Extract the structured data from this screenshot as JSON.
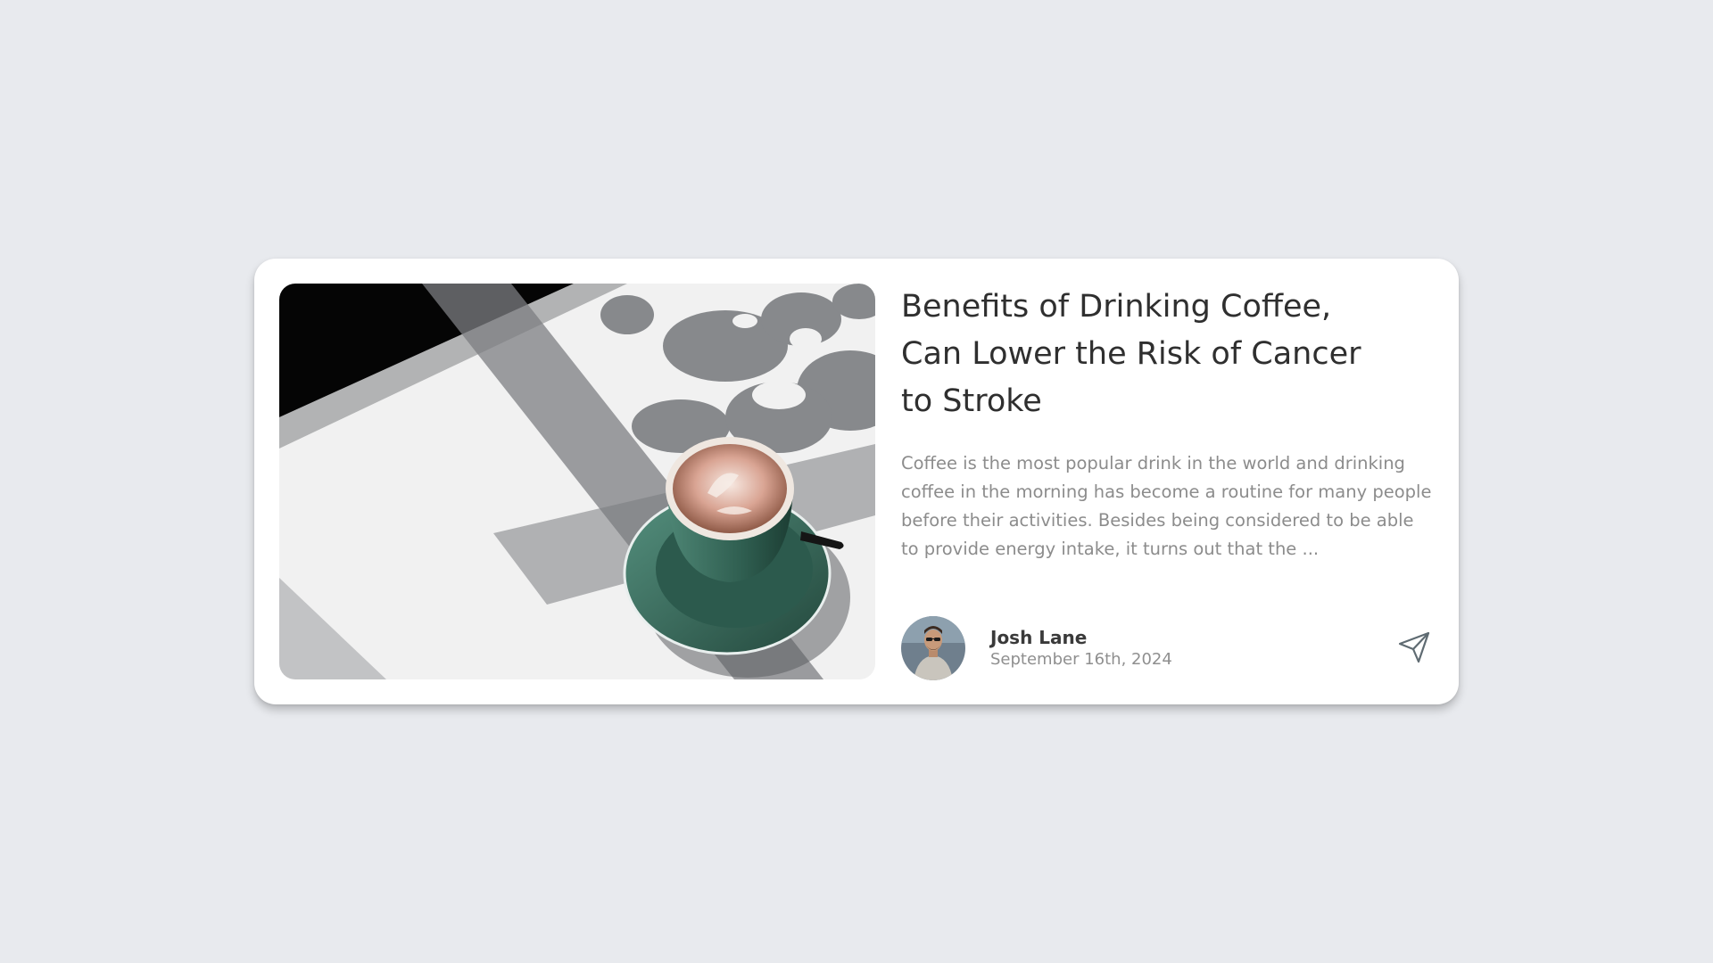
{
  "post": {
    "image": "coffee-cup-photo",
    "title": "Benefits of Drinking Coffee, Can Lower the Risk of Cancer to Stroke",
    "excerpt": "Coffee is the most popular drink in the world and drinking coffee in the morning has become a routine for many people before their activities. Besides being considered to be able to provide energy intake, it turns out that the ...",
    "author": {
      "name": "Josh Lane",
      "date": "September 16th, 2024",
      "avatar": "avatar-photo"
    },
    "share_icon": "paper-plane-icon"
  },
  "colors": {
    "background": "#e8eaee",
    "card": "#ffffff",
    "title": "#2f2f2f",
    "body_text": "#8c8c8c",
    "cup": "#3d6e5e"
  }
}
